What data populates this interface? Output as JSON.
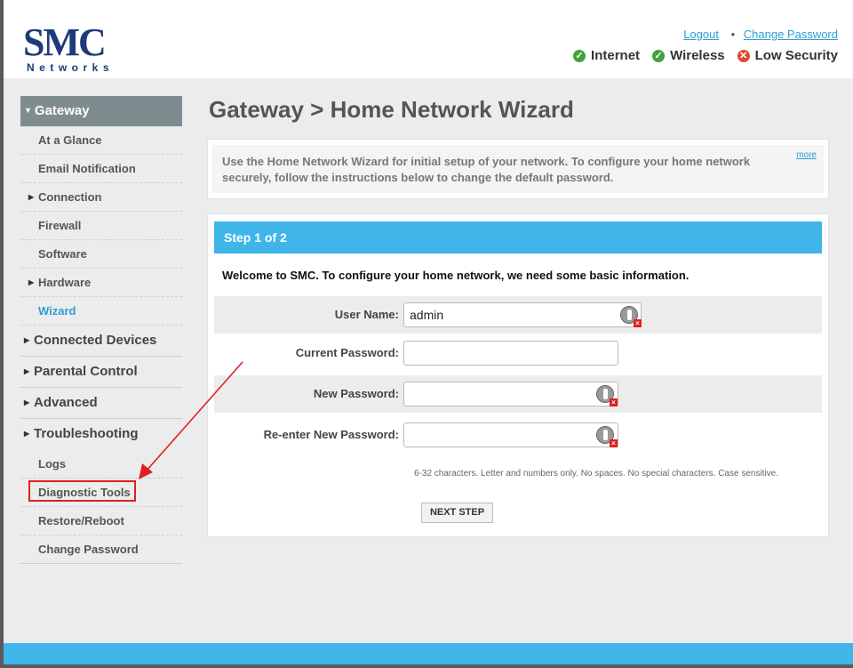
{
  "header": {
    "logo_main": "SMC",
    "logo_sub": "Networks",
    "logout": "Logout",
    "separator": "•",
    "change_password": "Change Password",
    "status": [
      {
        "label": "Internet",
        "state": "ok",
        "icon": "check-circle-icon",
        "color": "#3fa33c"
      },
      {
        "label": "Wireless",
        "state": "ok",
        "icon": "check-circle-icon",
        "color": "#3fa33c"
      },
      {
        "label": "Low Security",
        "state": "bad",
        "icon": "x-circle-icon",
        "color": "#e04a35"
      }
    ]
  },
  "sidebar": {
    "gateway": "Gateway",
    "gateway_items": [
      {
        "label": "At a Glance"
      },
      {
        "label": "Email Notification"
      },
      {
        "label": "Connection",
        "expandable": true
      },
      {
        "label": "Firewall"
      },
      {
        "label": "Software"
      },
      {
        "label": "Hardware",
        "expandable": true
      },
      {
        "label": "Wizard",
        "active": true
      }
    ],
    "groups": [
      {
        "label": "Connected Devices"
      },
      {
        "label": "Parental Control"
      },
      {
        "label": "Advanced"
      },
      {
        "label": "Troubleshooting"
      }
    ],
    "troubleshooting_items": [
      {
        "label": "Logs"
      },
      {
        "label": "Diagnostic Tools",
        "highlighted": true
      },
      {
        "label": "Restore/Reboot"
      },
      {
        "label": "Change Password"
      }
    ]
  },
  "main": {
    "title": "Gateway > Home Network Wizard",
    "info_text": "Use the Home Network Wizard for initial setup of your network. To configure your home network securely, follow the instructions below to change the default password.",
    "more": "more",
    "step": "Step 1 of 2",
    "welcome": "Welcome to SMC. To configure your home network, we need some basic information.",
    "fields": {
      "username_label": "User Name:",
      "username_value": "admin",
      "current_password_label": "Current Password:",
      "new_password_label": "New Password:",
      "reenter_password_label": "Re-enter New Password:"
    },
    "hint": "6-32 characters. Letter and numbers only. No spaces. No special characters. Case sensitive.",
    "next_button": "NEXT STEP"
  },
  "colors": {
    "accent": "#3fb5ea",
    "annotation": "#e02020",
    "active_link": "#2a9fd6"
  }
}
